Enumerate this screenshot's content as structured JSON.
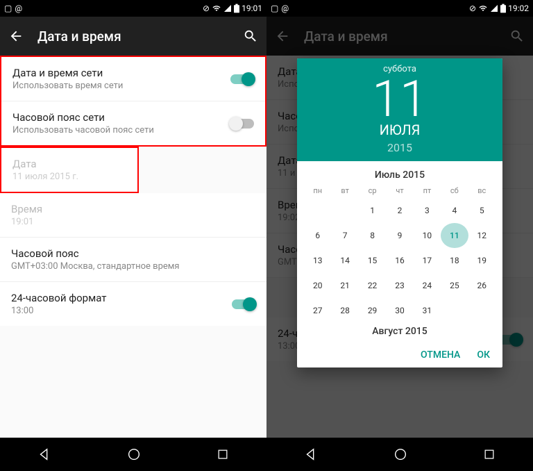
{
  "left": {
    "status_time": "19:01",
    "appbar_title": "Дата и время",
    "items": [
      {
        "primary": "Дата и время сети",
        "secondary": "Использовать время сети",
        "switch": "on"
      },
      {
        "primary": "Часовой пояс сети",
        "secondary": "Использовать часовой пояс сети",
        "switch": "off"
      },
      {
        "primary": "Дата",
        "secondary": "11 июля 2015 г.",
        "disabled": true
      },
      {
        "primary": "Время",
        "secondary": "19:01",
        "disabled": true
      },
      {
        "primary": "Часовой пояс",
        "secondary": "GMT+03:00 Москва, стандартное время"
      },
      {
        "primary": "24-часовой формат",
        "secondary": "13:00",
        "switch": "on"
      }
    ]
  },
  "right": {
    "status_time": "19:02",
    "appbar_title": "Дата и время",
    "bg_items": [
      {
        "primary": "Дата",
        "secondary": "Испо"
      },
      {
        "primary": "Часо",
        "secondary": "Испо"
      },
      {
        "primary": "Дата",
        "secondary": "11 и"
      },
      {
        "primary": "Врем",
        "secondary": "19:02"
      },
      {
        "primary": "Часо",
        "secondary": "GMT+"
      },
      {
        "primary": "24-ча",
        "secondary": "13:00"
      }
    ],
    "picker": {
      "dow": "суббота",
      "day": "11",
      "month": "ИЮЛЯ",
      "year": "2015",
      "cal_title": "Июль 2015",
      "dows": [
        "пн",
        "вт",
        "ср",
        "чт",
        "пт",
        "сб",
        "вс"
      ],
      "offset": 2,
      "days": 31,
      "selected": 11,
      "next_title": "Август 2015",
      "cancel": "ОТМЕНА",
      "ok": "ОК"
    }
  }
}
